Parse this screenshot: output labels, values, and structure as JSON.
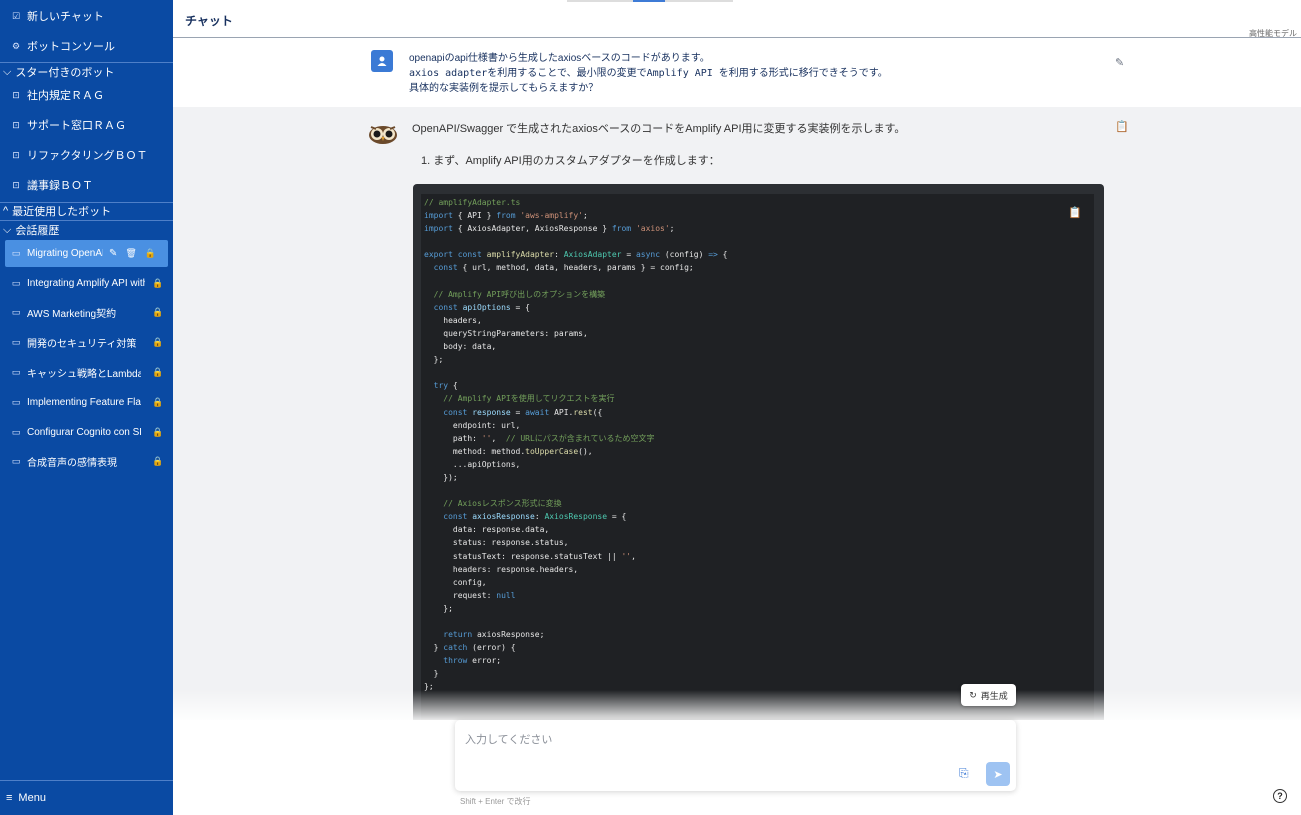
{
  "sidebar": {
    "new_chat": "新しいチャット",
    "bot_console": "ボットコンソール",
    "starred_section": "スター付きのボット",
    "starred_bots": [
      "社内規定ＲＡＧ",
      "サポート窓口ＲＡＧ",
      "リファクタリングＢＯＴ",
      "議事録ＢＯＴ"
    ],
    "recent_section": "最近使用したボット",
    "history_section": "会話履歴",
    "conversations": [
      {
        "title": "Migrating OpenAPI Axios Code to Amplify API"
      },
      {
        "title": "Integrating Amplify API with Axios"
      },
      {
        "title": "AWS Marketing契約"
      },
      {
        "title": "開発のセキュリティ対策"
      },
      {
        "title": "キャッシュ戦略とLambda"
      },
      {
        "title": "Implementing Feature Flags"
      },
      {
        "title": "Configurar Cognito con SDK"
      },
      {
        "title": "合成音声の感情表現"
      }
    ],
    "menu": "Menu"
  },
  "header": {
    "title": "チャット",
    "model_label": "高性能モデル"
  },
  "messages": {
    "user_line1": "openapiのapi仕様書から生成したaxiosベースのコードがあります。",
    "user_line2": "axios adapterを利用することで、最小限の変更でAmplify API を利用する形式に移行できそうです。",
    "user_line3": "具体的な実装例を提示してもらえますか？",
    "bot_intro": "OpenAPI/Swagger で生成されたaxiosベースのコードをAmplify API用に変更する実装例を示します。",
    "bot_step": "1.  まず、Amplify API用のカスタムアダプターを作成します："
  },
  "regenerate_label": "再生成",
  "input": {
    "placeholder": "入力してください",
    "hint": "Shift + Enter で改行"
  },
  "icons": {
    "new_chat": "edit-square-icon",
    "console": "gear-icon",
    "bot": "bot-icon",
    "chat": "chat-bubble-icon",
    "lock": "lock-icon",
    "pencil": "pencil-icon",
    "trash": "trash-icon",
    "copy": "clipboard-icon",
    "send": "send-icon",
    "help": "question-icon"
  },
  "colors": {
    "sidebar": "#0a4aa3",
    "active_item": "#4a90e2",
    "accent": "#3e7bd6",
    "code_bg": "#1f2124"
  }
}
